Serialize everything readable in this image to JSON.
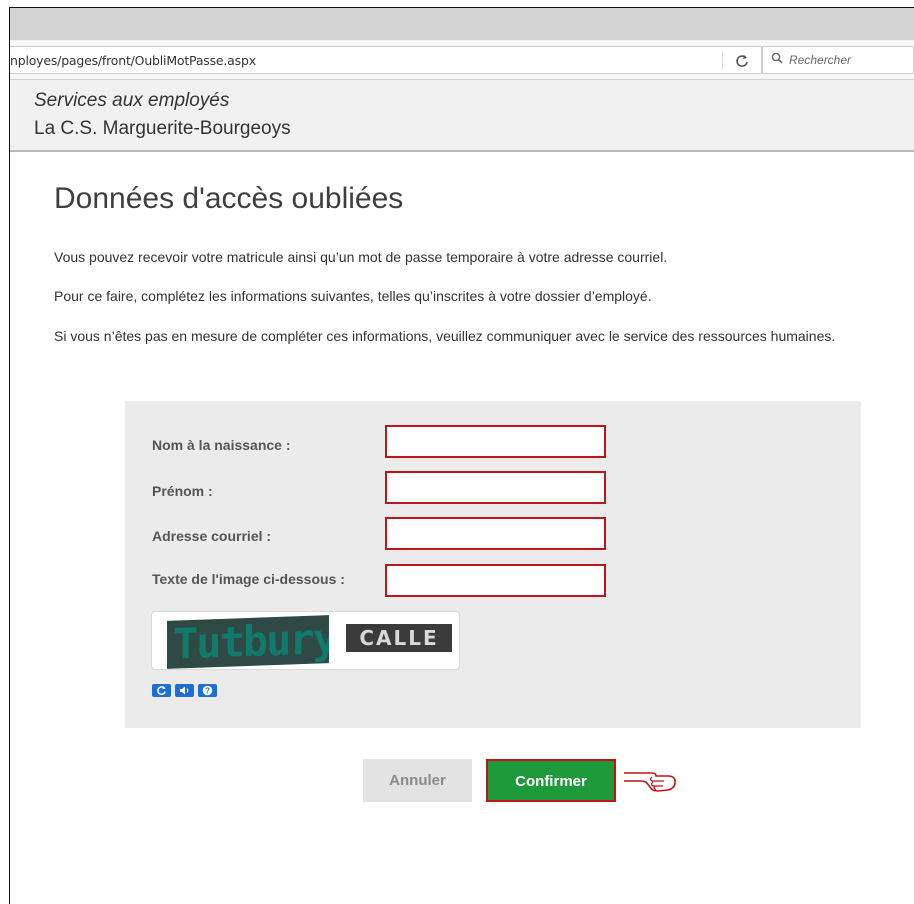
{
  "browser": {
    "url": "nployes/pages/front/OubliMotPasse.aspx",
    "reload_icon": "C",
    "search_placeholder": "Rechercher"
  },
  "header": {
    "subtitle": "Services aux employés",
    "title": "La C.S. Marguerite-Bourgeoys"
  },
  "main": {
    "page_title": "Données d'accès oubliées",
    "paragraphs": [
      "Vous pouvez recevoir votre matricule ainsi qu’un mot de passe temporaire à votre adresse courriel.",
      "Pour ce faire, complétez les informations suivantes, telles qu’inscrites à votre dossier d’employé.",
      "Si vous n’êtes pas en mesure de compléter ces informations, veuillez communiquer avec le service des ressources humaines."
    ]
  },
  "form": {
    "fields": [
      {
        "label": "Nom à la naissance :",
        "value": ""
      },
      {
        "label": "Prénom :",
        "value": ""
      },
      {
        "label": "Adresse courriel :",
        "value": ""
      },
      {
        "label": "Texte de l'image ci-dessous :",
        "value": ""
      }
    ],
    "captcha_words": [
      "Tutbury",
      "CALLE"
    ],
    "captcha_buttons": [
      "refresh-icon",
      "audio-icon",
      "help-icon"
    ]
  },
  "actions": {
    "cancel_label": "Annuler",
    "confirm_label": "Confirmer",
    "pointer_icon": "pointing-hand-icon"
  },
  "colors": {
    "highlight_border": "#c0141b",
    "confirm_bg": "#1f9a3a",
    "panel_bg": "#ebebeb"
  }
}
